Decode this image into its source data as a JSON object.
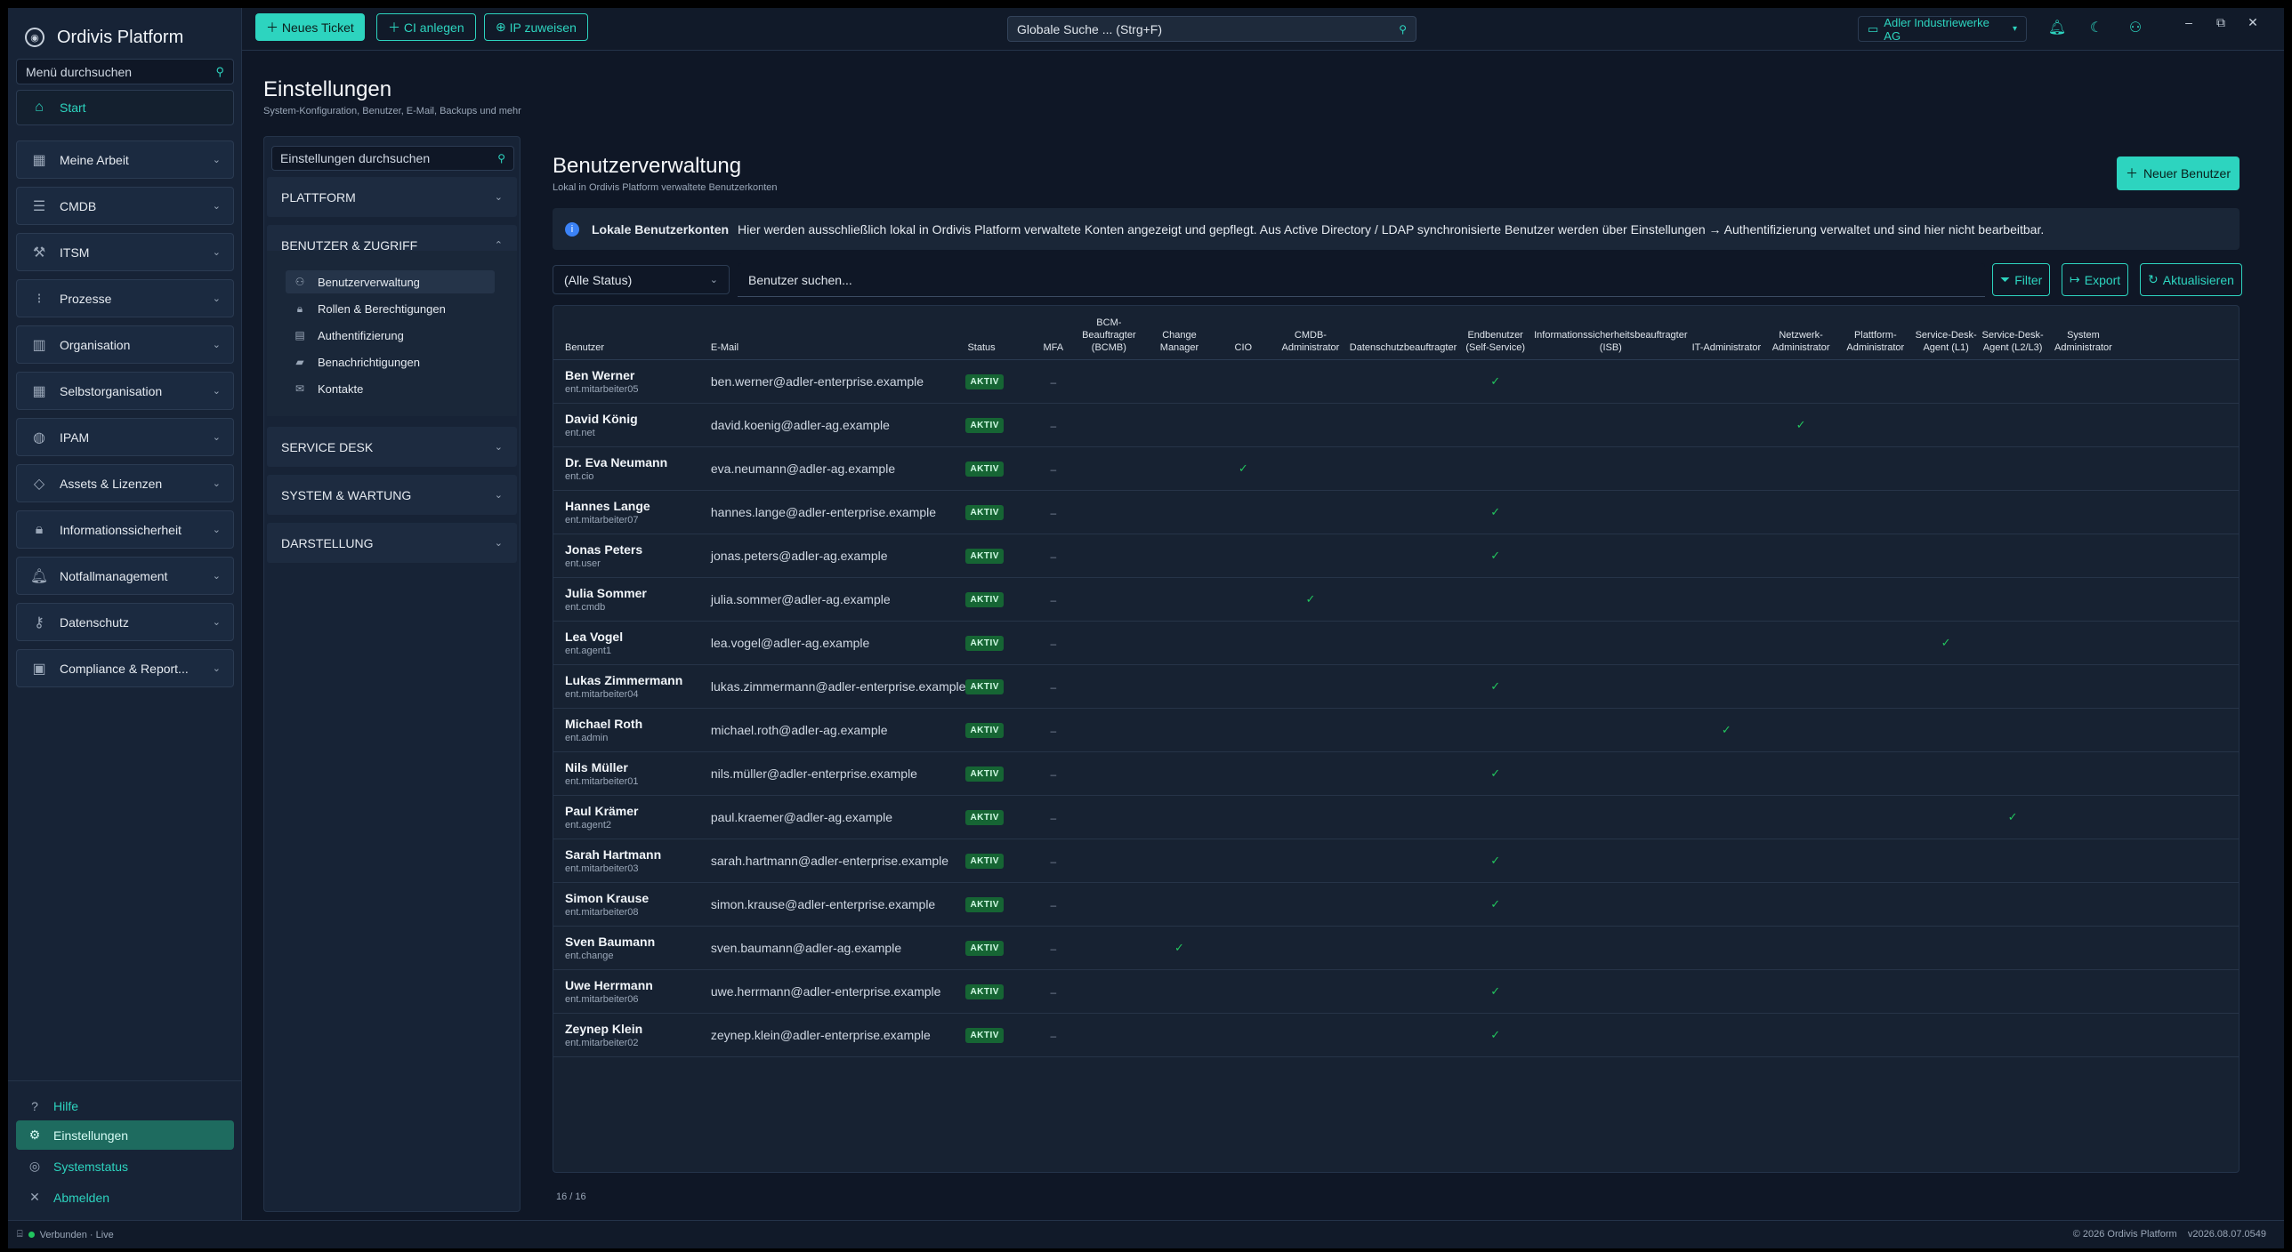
{
  "app": {
    "name": "Ordivis Platform"
  },
  "sidebar": {
    "search_placeholder": "Menü durchsuchen",
    "start": "Start",
    "items": [
      {
        "label": "Meine Arbeit",
        "icon": "calendar-icon"
      },
      {
        "label": "CMDB",
        "icon": "list-icon"
      },
      {
        "label": "ITSM",
        "icon": "wrench-icon"
      },
      {
        "label": "Prozesse",
        "icon": "flow-icon"
      },
      {
        "label": "Organisation",
        "icon": "building-icon"
      },
      {
        "label": "Selbstorganisation",
        "icon": "calendar-icon"
      },
      {
        "label": "IPAM",
        "icon": "globe-icon"
      },
      {
        "label": "Assets & Lizenzen",
        "icon": "tag-icon"
      },
      {
        "label": "Informationssicherheit",
        "icon": "lock-icon"
      },
      {
        "label": "Notfallmanagement",
        "icon": "bell-icon"
      },
      {
        "label": "Datenschutz",
        "icon": "key-icon"
      },
      {
        "label": "Compliance & Report...",
        "icon": "report-icon"
      }
    ],
    "bottom": {
      "help": "Hilfe",
      "settings": "Einstellungen",
      "status": "Systemstatus",
      "logout": "Abmelden"
    }
  },
  "topbar": {
    "new_ticket": "Neues Ticket",
    "new_ci": "CI anlegen",
    "assign_ip": "IP zuweisen",
    "search_placeholder": "Globale Suche ... (Strg+F)",
    "org": "Adler Industriewerke AG"
  },
  "page": {
    "title": "Einstellungen",
    "subtitle": "System-Konfiguration, Benutzer, E-Mail, Backups und mehr"
  },
  "settings_nav": {
    "search_placeholder": "Einstellungen durchsuchen",
    "groups": [
      "PLATTFORM",
      "BENUTZER & ZUGRIFF",
      "SERVICE DESK",
      "SYSTEM & WARTUNG",
      "DARSTELLUNG"
    ],
    "sub_items": [
      "Benutzerverwaltung",
      "Rollen & Berechtigungen",
      "Authentifizierung",
      "Benachrichtigungen",
      "Kontakte"
    ]
  },
  "content": {
    "title": "Benutzerverwaltung",
    "subtitle": "Lokal in Ordivis Platform verwaltete Benutzerkonten",
    "new_user": "Neuer Benutzer",
    "info_title": "Lokale Benutzerkonten",
    "info_text": "Hier werden ausschließlich lokal in Ordivis Platform verwaltete Konten angezeigt und gepflegt. Aus Active Directory / LDAP synchronisierte Benutzer werden über Einstellungen → Authentifizierung verwaltet und sind hier nicht bearbeitbar.",
    "status_filter": "(Alle Status)",
    "user_search_placeholder": "Benutzer suchen...",
    "filter": "Filter",
    "export": "Export",
    "refresh": "Aktualisieren",
    "count": "16 / 16"
  },
  "table": {
    "headers": [
      "Benutzer",
      "E-Mail",
      "Status",
      "MFA",
      "BCM-Beauftragter (BCMB)",
      "Change Manager",
      "CIO",
      "CMDB-Administrator",
      "Datenschutzbeauftragter",
      "Endbenutzer (Self-Service)",
      "Informationssicherheitsbeauftragter (ISB)",
      "IT-Administrator",
      "Netzwerk-Administrator",
      "Plattform-Administrator",
      "Service-Desk-Agent (L1)",
      "Service-Desk-Agent (L2/L3)",
      "System Administrator"
    ],
    "status_label": "AKTIV",
    "mfa_label": "–",
    "check": "✓",
    "rows": [
      {
        "name": "Ben Werner",
        "login": "ent.mitarbeiter05",
        "email": "ben.werner@adler-enterprise.example",
        "role": 5
      },
      {
        "name": "David König",
        "login": "ent.net",
        "email": "david.koenig@adler-ag.example",
        "role": 8
      },
      {
        "name": "Dr. Eva Neumann",
        "login": "ent.cio",
        "email": "eva.neumann@adler-ag.example",
        "role": 2
      },
      {
        "name": "Hannes Lange",
        "login": "ent.mitarbeiter07",
        "email": "hannes.lange@adler-enterprise.example",
        "role": 5
      },
      {
        "name": "Jonas Peters",
        "login": "ent.user",
        "email": "jonas.peters@adler-ag.example",
        "role": 5
      },
      {
        "name": "Julia Sommer",
        "login": "ent.cmdb",
        "email": "julia.sommer@adler-ag.example",
        "role": 3
      },
      {
        "name": "Lea Vogel",
        "login": "ent.agent1",
        "email": "lea.vogel@adler-ag.example",
        "role": 10
      },
      {
        "name": "Lukas Zimmermann",
        "login": "ent.mitarbeiter04",
        "email": "lukas.zimmermann@adler-enterprise.example",
        "role": 5
      },
      {
        "name": "Michael Roth",
        "login": "ent.admin",
        "email": "michael.roth@adler-ag.example",
        "role": 7
      },
      {
        "name": "Nils Müller",
        "login": "ent.mitarbeiter01",
        "email": "nils.müller@adler-enterprise.example",
        "role": 5
      },
      {
        "name": "Paul Krämer",
        "login": "ent.agent2",
        "email": "paul.kraemer@adler-ag.example",
        "role": 11
      },
      {
        "name": "Sarah Hartmann",
        "login": "ent.mitarbeiter03",
        "email": "sarah.hartmann@adler-enterprise.example",
        "role": 5
      },
      {
        "name": "Simon Krause",
        "login": "ent.mitarbeiter08",
        "email": "simon.krause@adler-enterprise.example",
        "role": 5
      },
      {
        "name": "Sven Baumann",
        "login": "ent.change",
        "email": "sven.baumann@adler-ag.example",
        "role": 1
      },
      {
        "name": "Uwe Herrmann",
        "login": "ent.mitarbeiter06",
        "email": "uwe.herrmann@adler-enterprise.example",
        "role": 5
      },
      {
        "name": "Zeynep Klein",
        "login": "ent.mitarbeiter02",
        "email": "zeynep.klein@adler-enterprise.example",
        "role": 5
      }
    ]
  },
  "footer": {
    "connection": "Verbunden · Live",
    "copyright": "© 2026 Ordivis Platform",
    "version": "v2026.08.07.0549"
  },
  "colors": {
    "accent": "#2dd4bf",
    "background": "#0f1726",
    "active_badge": "#166534"
  }
}
